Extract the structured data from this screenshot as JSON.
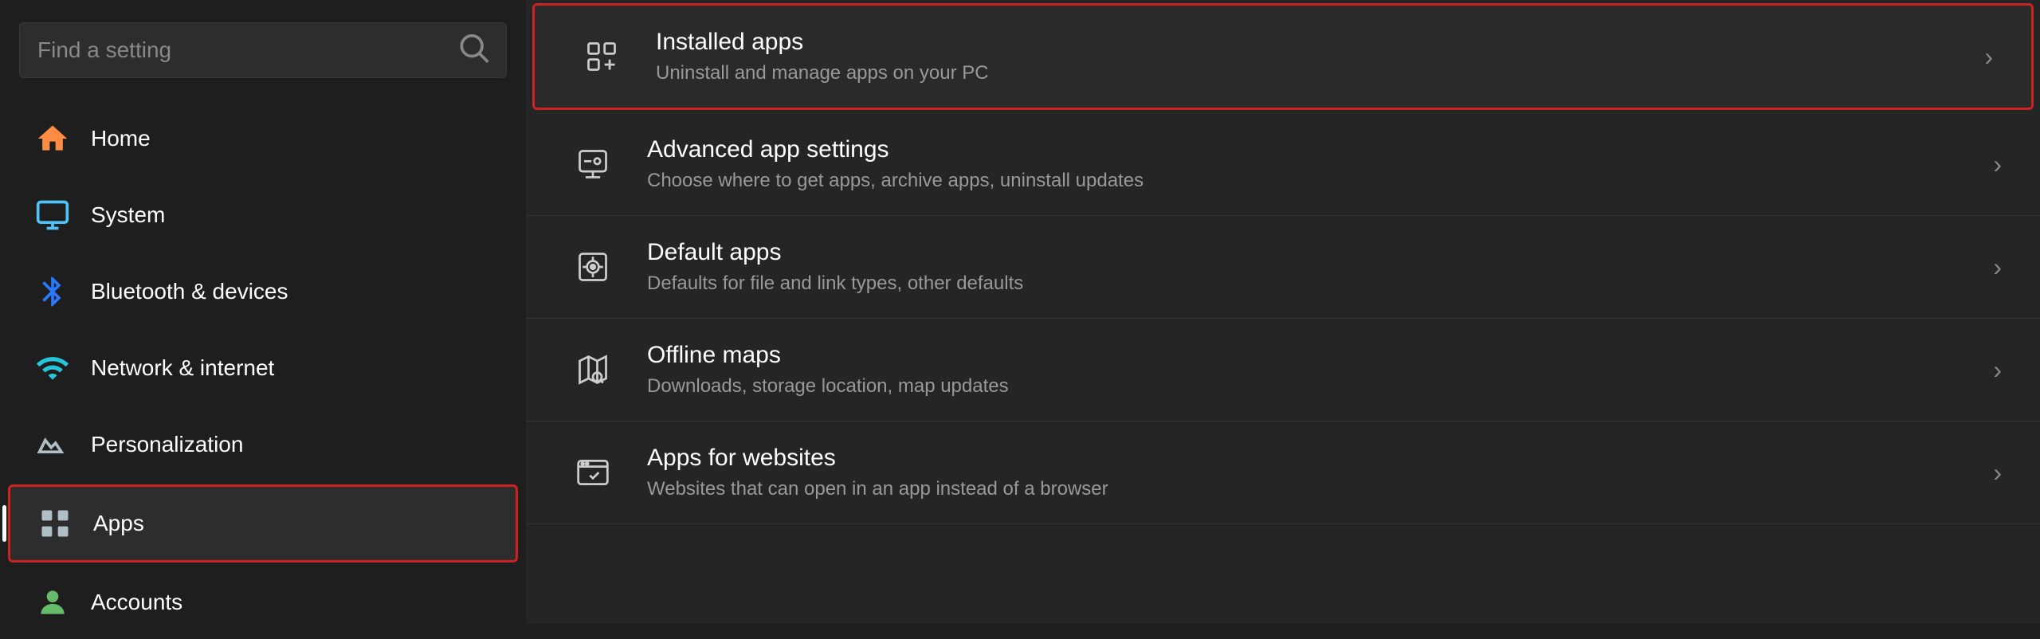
{
  "sidebar": {
    "search_placeholder": "Find a setting",
    "nav_items": [
      {
        "id": "home",
        "label": "Home",
        "icon": "home",
        "active": false
      },
      {
        "id": "system",
        "label": "System",
        "icon": "system",
        "active": false
      },
      {
        "id": "bluetooth",
        "label": "Bluetooth & devices",
        "icon": "bluetooth",
        "active": false
      },
      {
        "id": "network",
        "label": "Network & internet",
        "icon": "network",
        "active": false
      },
      {
        "id": "personalization",
        "label": "Personalization",
        "icon": "personalization",
        "active": false
      },
      {
        "id": "apps",
        "label": "Apps",
        "icon": "apps",
        "active": true,
        "highlighted": true
      },
      {
        "id": "accounts",
        "label": "Accounts",
        "icon": "accounts",
        "active": false
      }
    ]
  },
  "main": {
    "settings_items": [
      {
        "id": "installed-apps",
        "title": "Installed apps",
        "description": "Uninstall and manage apps on your PC",
        "highlighted": true
      },
      {
        "id": "advanced-app-settings",
        "title": "Advanced app settings",
        "description": "Choose where to get apps, archive apps, uninstall updates",
        "highlighted": false
      },
      {
        "id": "default-apps",
        "title": "Default apps",
        "description": "Defaults for file and link types, other defaults",
        "highlighted": false
      },
      {
        "id": "offline-maps",
        "title": "Offline maps",
        "description": "Downloads, storage location, map updates",
        "highlighted": false
      },
      {
        "id": "apps-for-websites",
        "title": "Apps for websites",
        "description": "Websites that can open in an app instead of a browser",
        "highlighted": false
      }
    ]
  }
}
